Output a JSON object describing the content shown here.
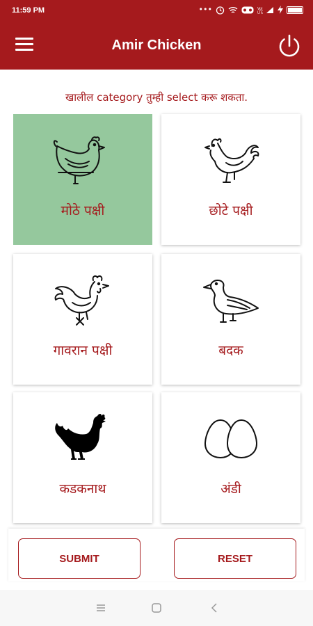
{
  "status_bar": {
    "time": "11:59 PM",
    "icons": [
      "dots-icon",
      "alarm-icon",
      "wifi-icon",
      "vr-icon",
      "signal-icon",
      "charge-icon",
      "battery-icon"
    ]
  },
  "app_bar": {
    "title": "Amir Chicken",
    "menu_icon": "hamburger-menu-icon",
    "power_icon": "power-icon"
  },
  "main": {
    "subtitle": "खालील category तुम्ही select करू शकता.",
    "categories": [
      {
        "label": "मोठे पक्षी",
        "icon": "hen-outline-icon",
        "selected": true
      },
      {
        "label": "छोटे पक्षी",
        "icon": "rooster-outline-icon",
        "selected": false
      },
      {
        "label": "गावरान पक्षी",
        "icon": "country-rooster-icon",
        "selected": false
      },
      {
        "label": "बदक",
        "icon": "duck-icon",
        "selected": false
      },
      {
        "label": "कडकनाथ",
        "icon": "black-rooster-icon",
        "selected": false
      },
      {
        "label": "अंडी",
        "icon": "eggs-icon",
        "selected": false
      }
    ]
  },
  "actions": {
    "submit_label": "SUBMIT",
    "reset_label": "RESET"
  },
  "nav_bar": {
    "icons": [
      "recent-apps-icon",
      "home-icon",
      "back-icon"
    ]
  },
  "colors": {
    "primary": "#a51a1d",
    "selected_tile": "#95c89d"
  }
}
